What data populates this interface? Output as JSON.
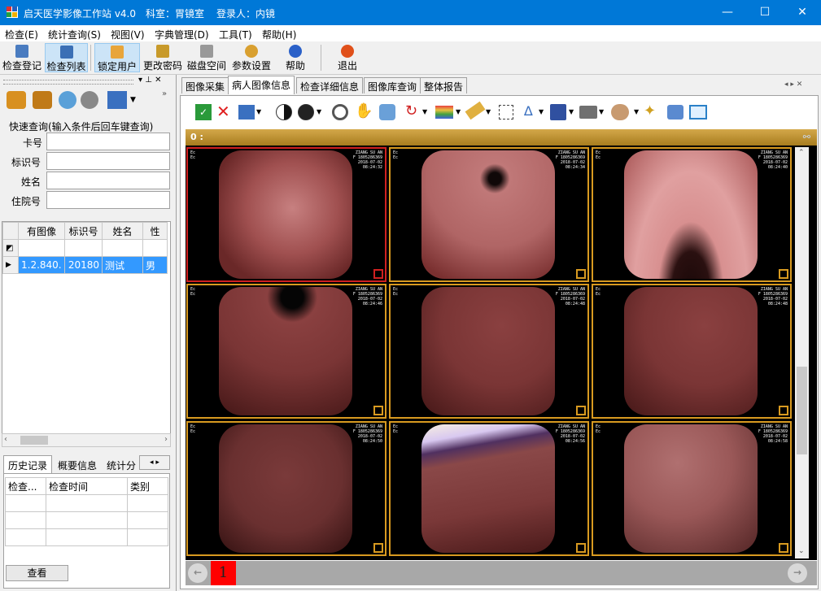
{
  "window": {
    "app_title": "启天医学影像工作站 v4.0",
    "dept": "科室：胃镜室",
    "login": "登录人：内镜",
    "min": "—",
    "max": "☐",
    "close": "✕"
  },
  "menu": [
    "检查(E)",
    "统计查询(S)",
    "视图(V)",
    "字典管理(D)",
    "工具(T)",
    "帮助(H)"
  ],
  "toolbar": {
    "register": "检查登记",
    "list": "检查列表",
    "lock": "锁定用户",
    "password": "更改密码",
    "disk": "磁盘空间",
    "settings": "参数设置",
    "help": "帮助",
    "exit": "退出"
  },
  "quick_query": {
    "title": "快速查询(输入条件后回车键查询)",
    "card": "卡号",
    "id": "标识号",
    "name": "姓名",
    "inpatient": "住院号"
  },
  "patient_table": {
    "headers": [
      "有图像",
      "标识号",
      "姓名",
      "性"
    ],
    "row": [
      "1.2.840.",
      "20180",
      "测试",
      "男"
    ]
  },
  "history": {
    "tabs": [
      "历史记录",
      "概要信息",
      "统计分"
    ],
    "headers": [
      "检查...",
      "检查时间",
      "类别"
    ],
    "view_button": "查看"
  },
  "main_tabs": [
    "图像采集",
    "病人图像信息",
    "检查详细信息",
    "图像库查询",
    "整体报告"
  ],
  "image_panel": {
    "header_label": "0 :",
    "page_number": "1"
  },
  "images": [
    {
      "l1": "Ec",
      "l2": "Ec",
      "r1": "ZIANG SU AN",
      "r2": "F  1805286369",
      "r3": "2018-07-02",
      "r4": "08:24:32"
    },
    {
      "l1": "Ec",
      "l2": "Ec",
      "r1": "ZIANG SU AN",
      "r2": "F  1805286369",
      "r3": "2018-07-02",
      "r4": "08:24:34"
    },
    {
      "l1": "Ec",
      "l2": "Ec",
      "r1": "ZIANG SU AN",
      "r2": "F  1805286369",
      "r3": "2018-07-02",
      "r4": "08:24:40"
    },
    {
      "l1": "Ec",
      "l2": "Ec",
      "r1": "ZIANG SU AN",
      "r2": "F  1805286369",
      "r3": "2018-07-02",
      "r4": "08:24:46"
    },
    {
      "l1": "Ec",
      "l2": "Ec",
      "r1": "ZIANG SU AN",
      "r2": "F  1805286369",
      "r3": "2018-07-02",
      "r4": "08:24:48"
    },
    {
      "l1": "Ec",
      "l2": "Ec",
      "r1": "ZIANG SU AN",
      "r2": "F  1805286369",
      "r3": "2018-07-02",
      "r4": "08:24:48"
    },
    {
      "l1": "Ec",
      "l2": "Ec",
      "r1": "ZIANG SU AN",
      "r2": "F  1805286369",
      "r3": "2018-07-02",
      "r4": "08:24:50"
    },
    {
      "l1": "Ec",
      "l2": "Ec",
      "r1": "ZIANG SU AN",
      "r2": "F  1805286369",
      "r3": "2018-07-02",
      "r4": "08:24:56"
    },
    {
      "l1": "Ec",
      "l2": "Ec",
      "r1": "ZIANG SU AN",
      "r2": "F  1805286369",
      "r3": "2018-07-02",
      "r4": "08:24:58"
    }
  ]
}
